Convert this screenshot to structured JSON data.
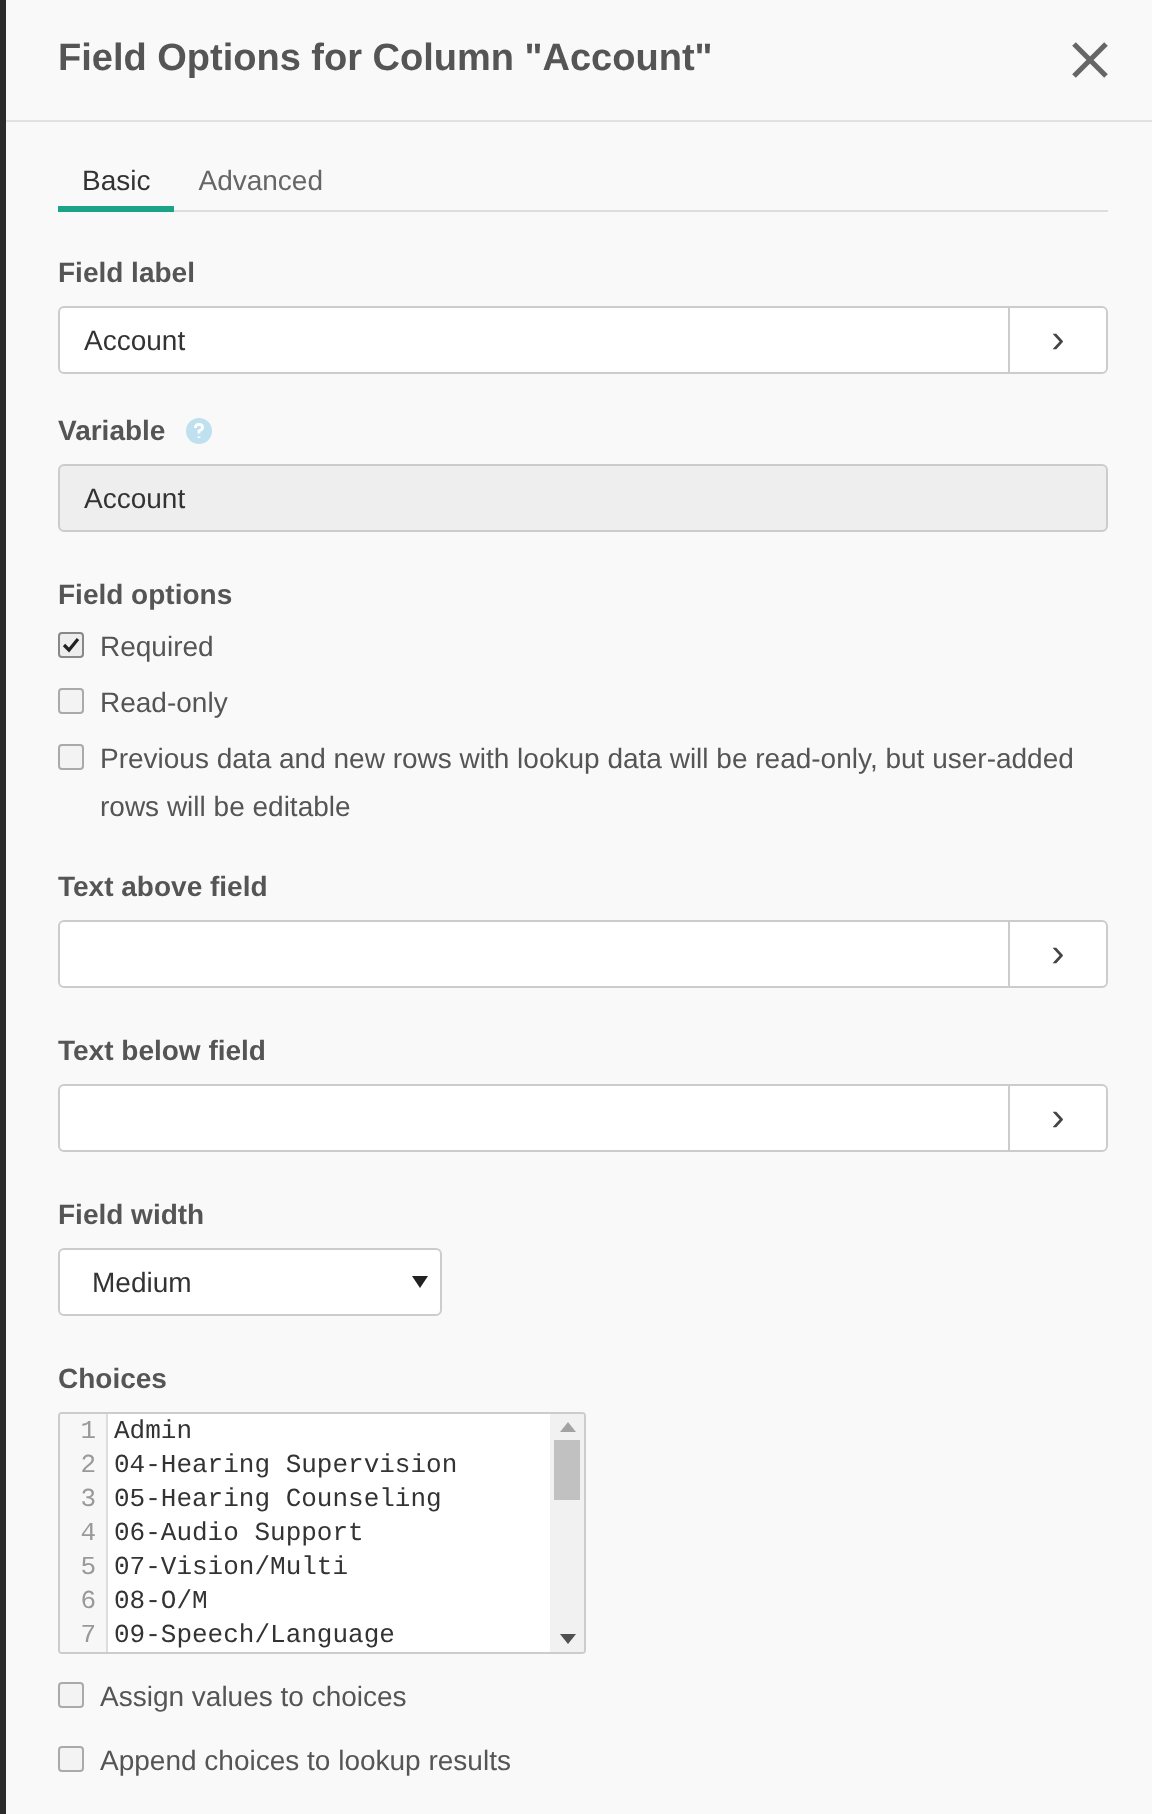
{
  "dialog": {
    "title": "Field Options for Column \"Account\""
  },
  "tabs": [
    {
      "label": "Basic",
      "selected": true
    },
    {
      "label": "Advanced",
      "selected": false
    }
  ],
  "field_label": {
    "label": "Field label",
    "value": "Account",
    "button": "›"
  },
  "variable": {
    "label": "Variable",
    "value": "Account",
    "disabled": true
  },
  "field_options": {
    "label": "Field options",
    "items": [
      {
        "label": "Required",
        "checked": true
      },
      {
        "label": "Read-only",
        "checked": false
      },
      {
        "label": "Previous data and new rows with lookup data will be read-only, but user-added rows will be editable",
        "checked": false
      }
    ]
  },
  "text_above": {
    "label": "Text above field",
    "button": "›"
  },
  "text_below": {
    "label": "Text below field",
    "button": "›"
  },
  "field_width": {
    "label": "Field width",
    "value": "Medium"
  },
  "choices": {
    "label": "Choices",
    "lines": [
      {
        "number": "1",
        "text": "Admin"
      },
      {
        "number": "2",
        "text": "04-Hearing Supervision"
      },
      {
        "number": "3",
        "text": "05-Hearing Counseling"
      },
      {
        "number": "4",
        "text": "06-Audio Support"
      },
      {
        "number": "5",
        "text": "07-Vision/Multi"
      },
      {
        "number": "6",
        "text": "08-O/M"
      },
      {
        "number": "7",
        "text": "09-Speech/Language"
      }
    ]
  },
  "bottom_options": [
    {
      "label": "Assign values to choices",
      "checked": false
    },
    {
      "label": "Append choices to lookup results",
      "checked": false
    }
  ]
}
